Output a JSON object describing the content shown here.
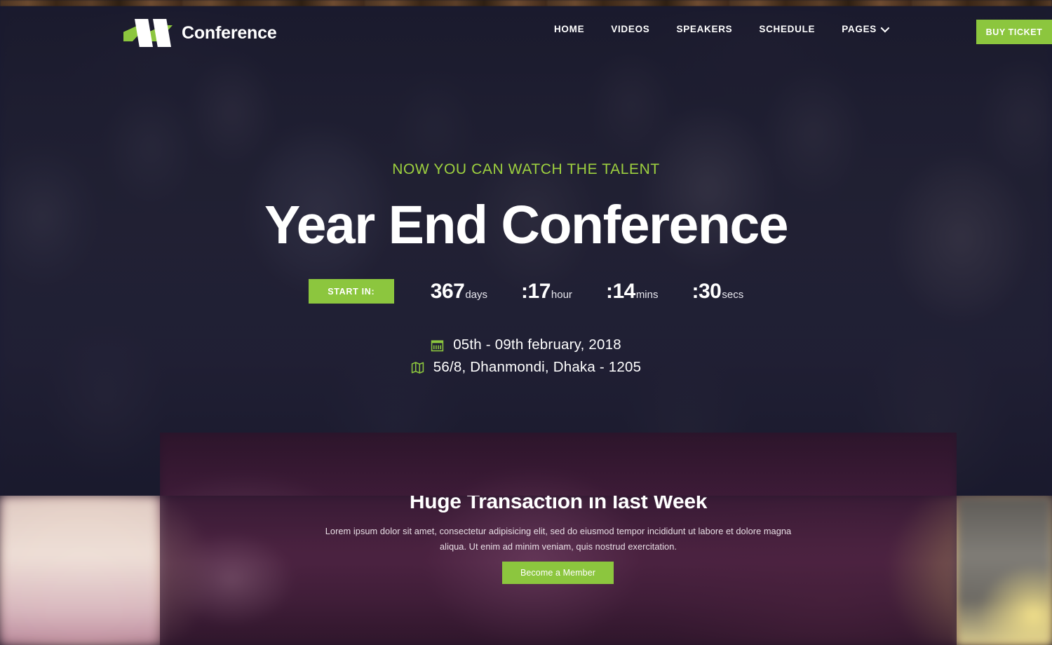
{
  "brand": {
    "name": "Conference",
    "logo_icon": "conference-logo-icon"
  },
  "colors": {
    "accent_green": "#8cc63e",
    "sub_green": "#9ed13f",
    "text_white": "#ffffff",
    "hero_overlay": "#16172f",
    "band_overlay": "#3c1a38"
  },
  "nav": {
    "items": [
      {
        "label": "HOME",
        "has_dropdown": false
      },
      {
        "label": "VIDEOS",
        "has_dropdown": false
      },
      {
        "label": "SPEAKERS",
        "has_dropdown": false
      },
      {
        "label": "SCHEDULE",
        "has_dropdown": false
      },
      {
        "label": "PAGES",
        "has_dropdown": true
      }
    ],
    "cta": {
      "label": "BUY TICKET"
    }
  },
  "hero": {
    "subtitle": "NOW YOU CAN WATCH THE TALENT",
    "title": "Year End Conference",
    "countdown": {
      "start_label": "START IN:",
      "units": [
        {
          "value": "367",
          "label": "days",
          "prefix": ""
        },
        {
          "value": "17",
          "label": "hour",
          "prefix": ":"
        },
        {
          "value": "14",
          "label": "mins",
          "prefix": ":"
        },
        {
          "value": "30",
          "label": "secs",
          "prefix": ":"
        }
      ]
    },
    "info": {
      "date_icon": "calendar-icon",
      "date": "05th - 09th february, 2018",
      "location_icon": "map-icon",
      "location": "56/8, Dhanmondi, Dhaka - 1205"
    }
  },
  "band": {
    "title": "Huge Transaction in last Week",
    "body": "Lorem ipsum dolor sit amet, consectetur adipisicing elit, sed do eiusmod tempor incididunt ut labore et dolore magna aliqua. Ut enim ad minim veniam, quis nostrud exercitation.",
    "cta": {
      "label": "Become a Member"
    }
  }
}
